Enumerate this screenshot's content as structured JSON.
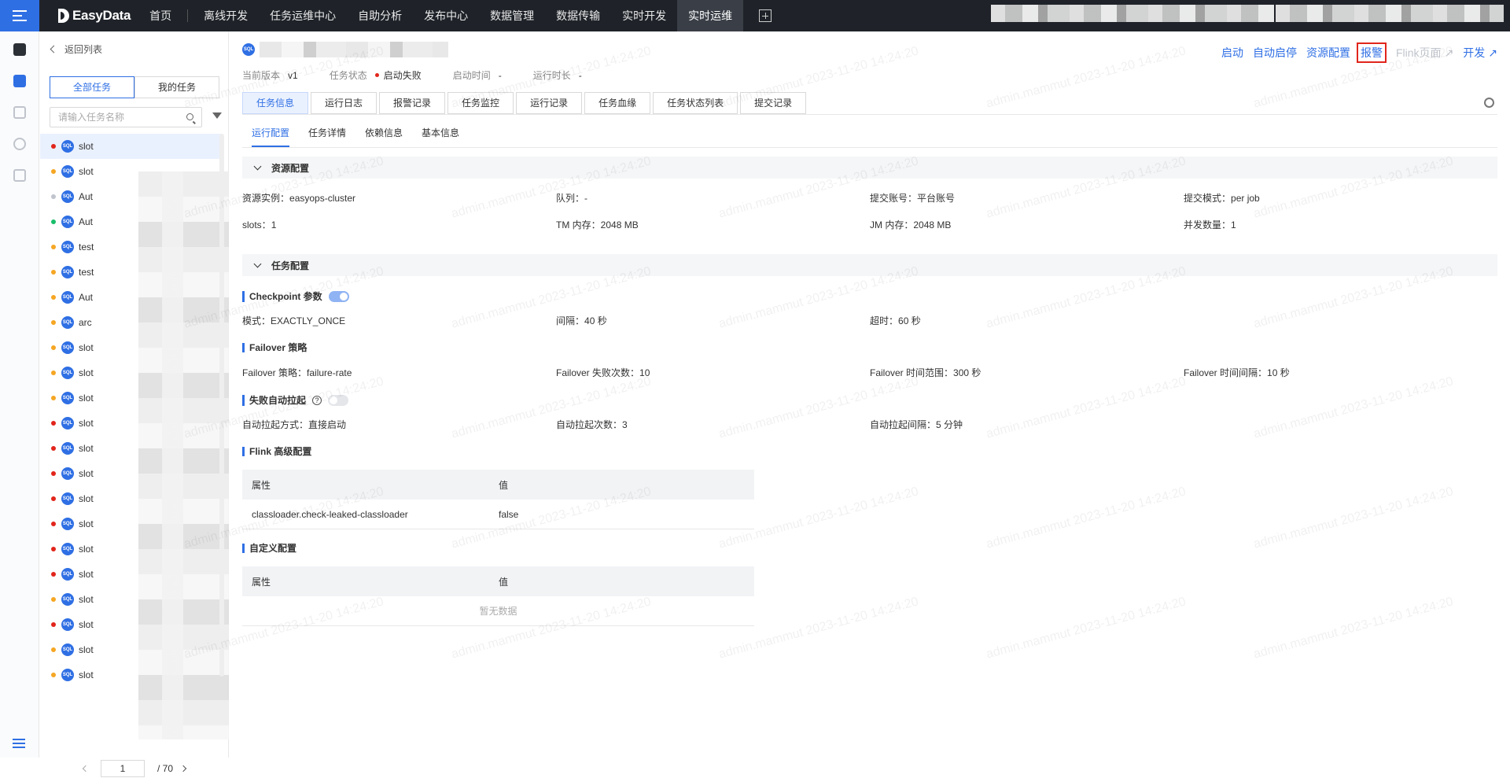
{
  "app": {
    "logo_text": "EasyData",
    "nav": [
      "首页",
      "离线开发",
      "任务运维中心",
      "自助分析",
      "发布中心",
      "数据管理",
      "数据传输",
      "实时开发",
      "实时运维"
    ],
    "active_nav": "实时运维"
  },
  "sidebar": {
    "back_label": "返回列表",
    "seg_all": "全部任务",
    "seg_mine": "我的任务",
    "search_placeholder": "请输入任务名称",
    "tasks": [
      {
        "name": "slot",
        "status": "#e1251b",
        "selected": true
      },
      {
        "name": "slot",
        "status": "#f5a623"
      },
      {
        "name": "Aut",
        "status": "#c0c4cc"
      },
      {
        "name": "Aut",
        "status": "#19be6b"
      },
      {
        "name": "test",
        "status": "#f5a623"
      },
      {
        "name": "test",
        "status": "#f5a623"
      },
      {
        "name": "Aut",
        "status": "#f5a623"
      },
      {
        "name": "arc",
        "status": "#f5a623"
      },
      {
        "name": "slot",
        "status": "#f5a623"
      },
      {
        "name": "slot",
        "status": "#f5a623"
      },
      {
        "name": "slot",
        "status": "#f5a623"
      },
      {
        "name": "slot",
        "status": "#e1251b"
      },
      {
        "name": "slot",
        "status": "#e1251b"
      },
      {
        "name": "slot",
        "status": "#e1251b"
      },
      {
        "name": "slot",
        "status": "#e1251b"
      },
      {
        "name": "slot",
        "status": "#e1251b"
      },
      {
        "name": "slot",
        "status": "#e1251b"
      },
      {
        "name": "slot",
        "status": "#e1251b"
      },
      {
        "name": "slot",
        "status": "#f5a623"
      },
      {
        "name": "slot",
        "status": "#e1251b"
      },
      {
        "name": "slot",
        "status": "#f5a623"
      },
      {
        "name": "slot",
        "status": "#f5a623"
      }
    ],
    "pager": {
      "current": "1",
      "total": "/ 70"
    }
  },
  "header": {
    "actions": {
      "start": "启动",
      "auto_restart": "自动启停",
      "resource": "资源配置",
      "alarm": "报警",
      "flink_page": "Flink页面",
      "develop": "开发"
    },
    "meta": {
      "version_label": "当前版本",
      "version_value": "v1",
      "status_label": "任务状态",
      "status_value": "启动失败",
      "start_label": "启动时间",
      "start_value": "-",
      "duration_label": "运行时长",
      "duration_value": "-"
    },
    "tabs": [
      "任务信息",
      "运行日志",
      "报警记录",
      "任务监控",
      "运行记录",
      "任务血缘",
      "任务状态列表",
      "提交记录"
    ],
    "subtabs": [
      "运行配置",
      "任务详情",
      "依赖信息",
      "基本信息"
    ]
  },
  "resource": {
    "title": "资源配置",
    "instance_label": "资源实例：",
    "instance_value": "easyops-cluster",
    "queue_label": "队列：",
    "queue_value": "-",
    "account_label": "提交账号：",
    "account_value": "平台账号",
    "mode_label": "提交模式：",
    "mode_value": "per job",
    "slots_label": "slots：",
    "slots_value": "1",
    "tm_label": "TM 内存：",
    "tm_value": "2048 MB",
    "jm_label": "JM 内存：",
    "jm_value": "2048 MB",
    "parallel_label": "并发数量：",
    "parallel_value": "1"
  },
  "task_config": {
    "title": "任务配置",
    "checkpoint_title": "Checkpoint 参数",
    "cp_mode_label": "模式：",
    "cp_mode_value": "EXACTLY_ONCE",
    "cp_interval_label": "间隔：",
    "cp_interval_value": "40 秒",
    "cp_timeout_label": "超时：",
    "cp_timeout_value": "60 秒",
    "failover_title": "Failover 策略",
    "fo_strategy_label": "Failover 策略：",
    "fo_strategy_value": "failure-rate",
    "fo_count_label": "Failover 失败次数：",
    "fo_count_value": "10",
    "fo_range_label": "Failover 时间范围：",
    "fo_range_value": "300 秒",
    "fo_interval_label": "Failover 时间间隔：",
    "fo_interval_value": "10 秒",
    "autorestart_title": "失败自动拉起",
    "ar_mode_label": "自动拉起方式：",
    "ar_mode_value": "直接启动",
    "ar_count_label": "自动拉起次数：",
    "ar_count_value": "3",
    "ar_interval_label": "自动拉起间隔：",
    "ar_interval_value": "5 分钟",
    "flink_title": "Flink 高级配置",
    "col_attr": "属性",
    "col_value": "值",
    "flink_rows": [
      {
        "k": "classloader.check-leaked-classloader",
        "v": "false"
      }
    ],
    "custom_title": "自定义配置",
    "empty_text": "暂无数据"
  },
  "watermark": "admin.mammut 2023-11-20 14:24:20"
}
